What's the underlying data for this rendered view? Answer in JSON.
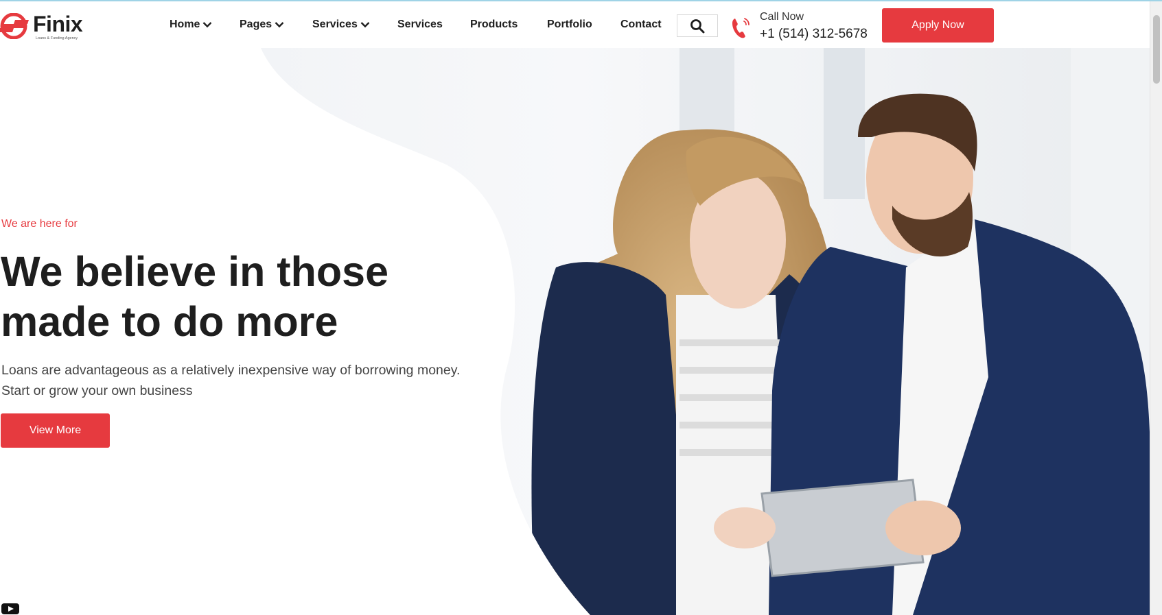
{
  "brand": {
    "name": "Finix",
    "tagline": "Loans & Funding Agency",
    "accent_color": "#e63a3f"
  },
  "nav": {
    "items": [
      {
        "label": "Home",
        "has_dropdown": true
      },
      {
        "label": "Pages",
        "has_dropdown": true
      },
      {
        "label": "Services",
        "has_dropdown": true
      },
      {
        "label": "Services",
        "has_dropdown": false
      },
      {
        "label": "Products",
        "has_dropdown": false
      },
      {
        "label": "Portfolio",
        "has_dropdown": false
      },
      {
        "label": "Contact",
        "has_dropdown": false
      }
    ],
    "search_icon": "search-icon"
  },
  "call": {
    "label": "Call Now",
    "number": "+1 (514) 312-5678",
    "icon": "phone-icon"
  },
  "apply_label": "Apply Now",
  "hero": {
    "eyebrow": "We are here for",
    "headline_line1": "We believe in those",
    "headline_line2": "made to do more",
    "lead_line1": "Loans are advantageous as a relatively inexpensive way of borrowing money.",
    "lead_line2": "Start or grow your own business",
    "button_label": "View More",
    "image": "business-couple-with-tablet"
  },
  "footer_icon": "youtube-icon"
}
